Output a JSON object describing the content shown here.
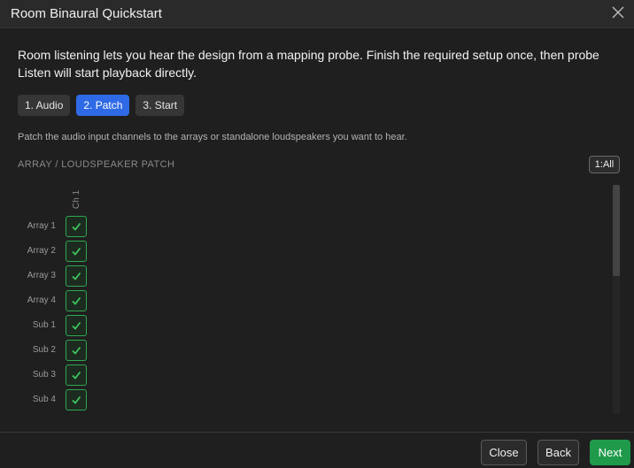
{
  "window": {
    "title": "Room Binaural Quickstart"
  },
  "intro": "Room listening lets you hear the design from a mapping probe. Finish the required setup once, then probe Listen will start playback directly.",
  "steps": [
    {
      "label": "1. Audio",
      "active": false
    },
    {
      "label": "2. Patch",
      "active": true
    },
    {
      "label": "3. Start",
      "active": false
    }
  ],
  "hint": "Patch the audio input channels to the arrays or standalone loudspeakers you want to hear.",
  "patch": {
    "section_label": "ARRAY / LOUDSPEAKER PATCH",
    "all_button": "1:All",
    "columns": [
      "Ch 1"
    ],
    "rows": [
      {
        "label": "Array 1",
        "checked": true
      },
      {
        "label": "Array 2",
        "checked": true
      },
      {
        "label": "Array 3",
        "checked": true
      },
      {
        "label": "Array 4",
        "checked": true
      },
      {
        "label": "Sub 1",
        "checked": true
      },
      {
        "label": "Sub 2",
        "checked": true
      },
      {
        "label": "Sub 3",
        "checked": true
      },
      {
        "label": "Sub 4",
        "checked": true
      }
    ]
  },
  "footer": {
    "close": "Close",
    "back": "Back",
    "next": "Next"
  },
  "colors": {
    "accent": "#2f6ae6",
    "check": "#2fa84f",
    "primary": "#1f9a4a",
    "background": "#1f1f1f"
  },
  "icons": {
    "close": "close-icon",
    "check": "checkmark-icon"
  }
}
